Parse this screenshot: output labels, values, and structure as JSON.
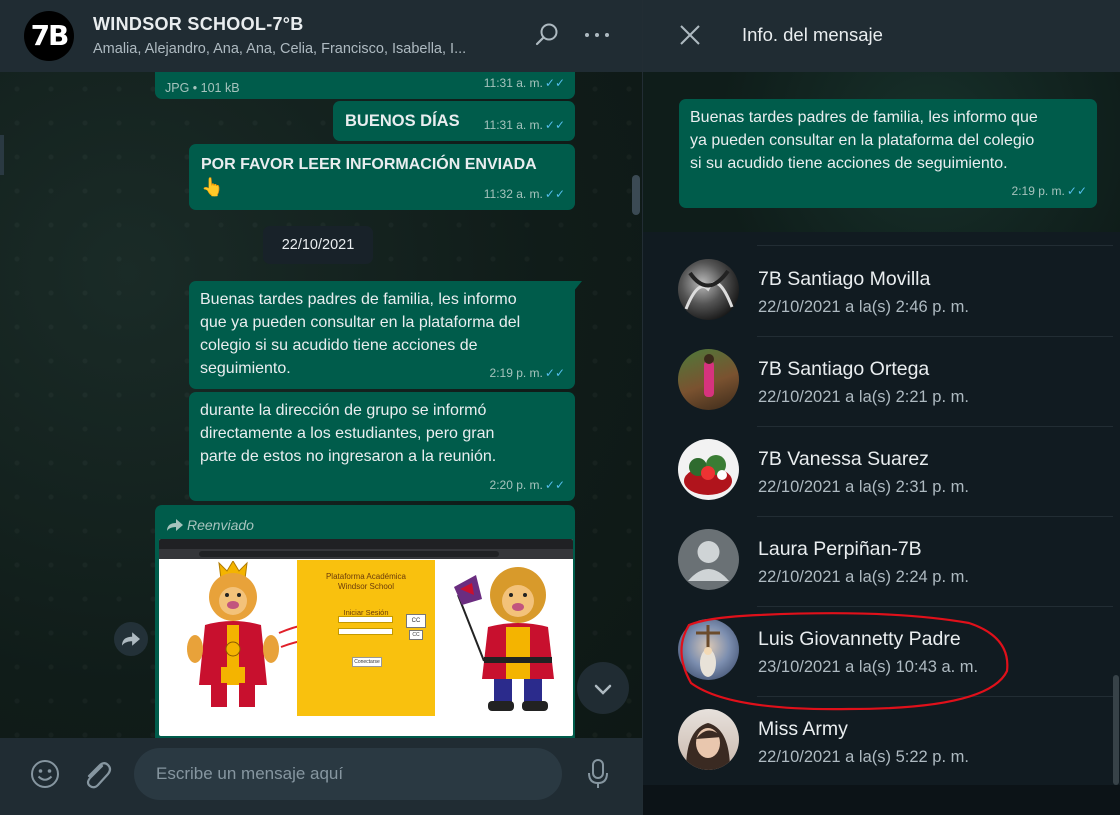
{
  "chat": {
    "avatar_text": "7B",
    "title": "WINDSOR SCHOOL-7°B",
    "members": "Amalia, Alejandro, Ana, Ana, Celia, Francisco, Isabella, I...",
    "messages": [
      {
        "meta": "JPG • 101 kB",
        "time": "11:31 a. m."
      },
      {
        "text": "BUENOS DÍAS",
        "time": "11:31 a. m."
      },
      {
        "text": "POR FAVOR LEER INFORMACIÓN ENVIADA",
        "emoji": "👆",
        "time": "11:32 a. m."
      },
      {
        "date": "22/10/2021"
      },
      {
        "lines": [
          "Buenas tardes padres de familia, les informo",
          "que ya pueden consultar en la plataforma del",
          "colegio si su acudido tiene acciones de",
          "seguimiento."
        ],
        "time": "2:19 p. m."
      },
      {
        "lines": [
          "durante la dirección de grupo se informó",
          "directamente a los estudiantes, pero gran",
          "parte de estos no ingresaron a la reunión."
        ],
        "time": "2:20 p. m."
      },
      {
        "forwarded_label": "Reenviado",
        "image": {
          "panel_title_1": "Plataforma Académica",
          "panel_title_2": "Windsor School",
          "panel_sub": "Iniciar Sesión",
          "btn_login": "Conectarse",
          "side_btn_1": "CC",
          "side_btn_2": "CC"
        }
      }
    ],
    "input_placeholder": "Escribe un mensaje aquí",
    "icons": [
      "search-icon",
      "more-icon",
      "emoji-icon",
      "attach-icon",
      "mic-icon",
      "share-icon",
      "chevron-down-icon"
    ]
  },
  "info": {
    "title": "Info. del mensaje",
    "preview": {
      "lines": [
        "Buenas tardes padres de familia, les informo que",
        "ya pueden consultar en la plataforma del colegio",
        "si su acudido tiene acciones de seguimiento."
      ],
      "time": "2:19 p. m."
    },
    "recipients": [
      {
        "name": "7B Santiago Movilla",
        "time": "22/10/2021 a la(s) 2:46 p. m."
      },
      {
        "name": "7B Santiago Ortega",
        "time": "22/10/2021 a la(s) 2:21 p. m."
      },
      {
        "name": "7B Vanessa Suarez",
        "time": "22/10/2021 a la(s) 2:31 p. m."
      },
      {
        "name": "Laura Perpiñan-7B",
        "time": "22/10/2021 a la(s) 2:24 p. m."
      },
      {
        "name": "Luis Giovannetty Padre",
        "time": "23/10/2021 a la(s) 10:43 a. m.",
        "highlighted": true
      },
      {
        "name": "Miss Army",
        "time": "22/10/2021 a la(s) 5:22 p. m."
      }
    ]
  },
  "colors": {
    "outgoing_bubble": "#005c4b",
    "tick": "#53bdeb",
    "highlight_ring": "#e0101a",
    "panel_bg": "#111b21"
  }
}
